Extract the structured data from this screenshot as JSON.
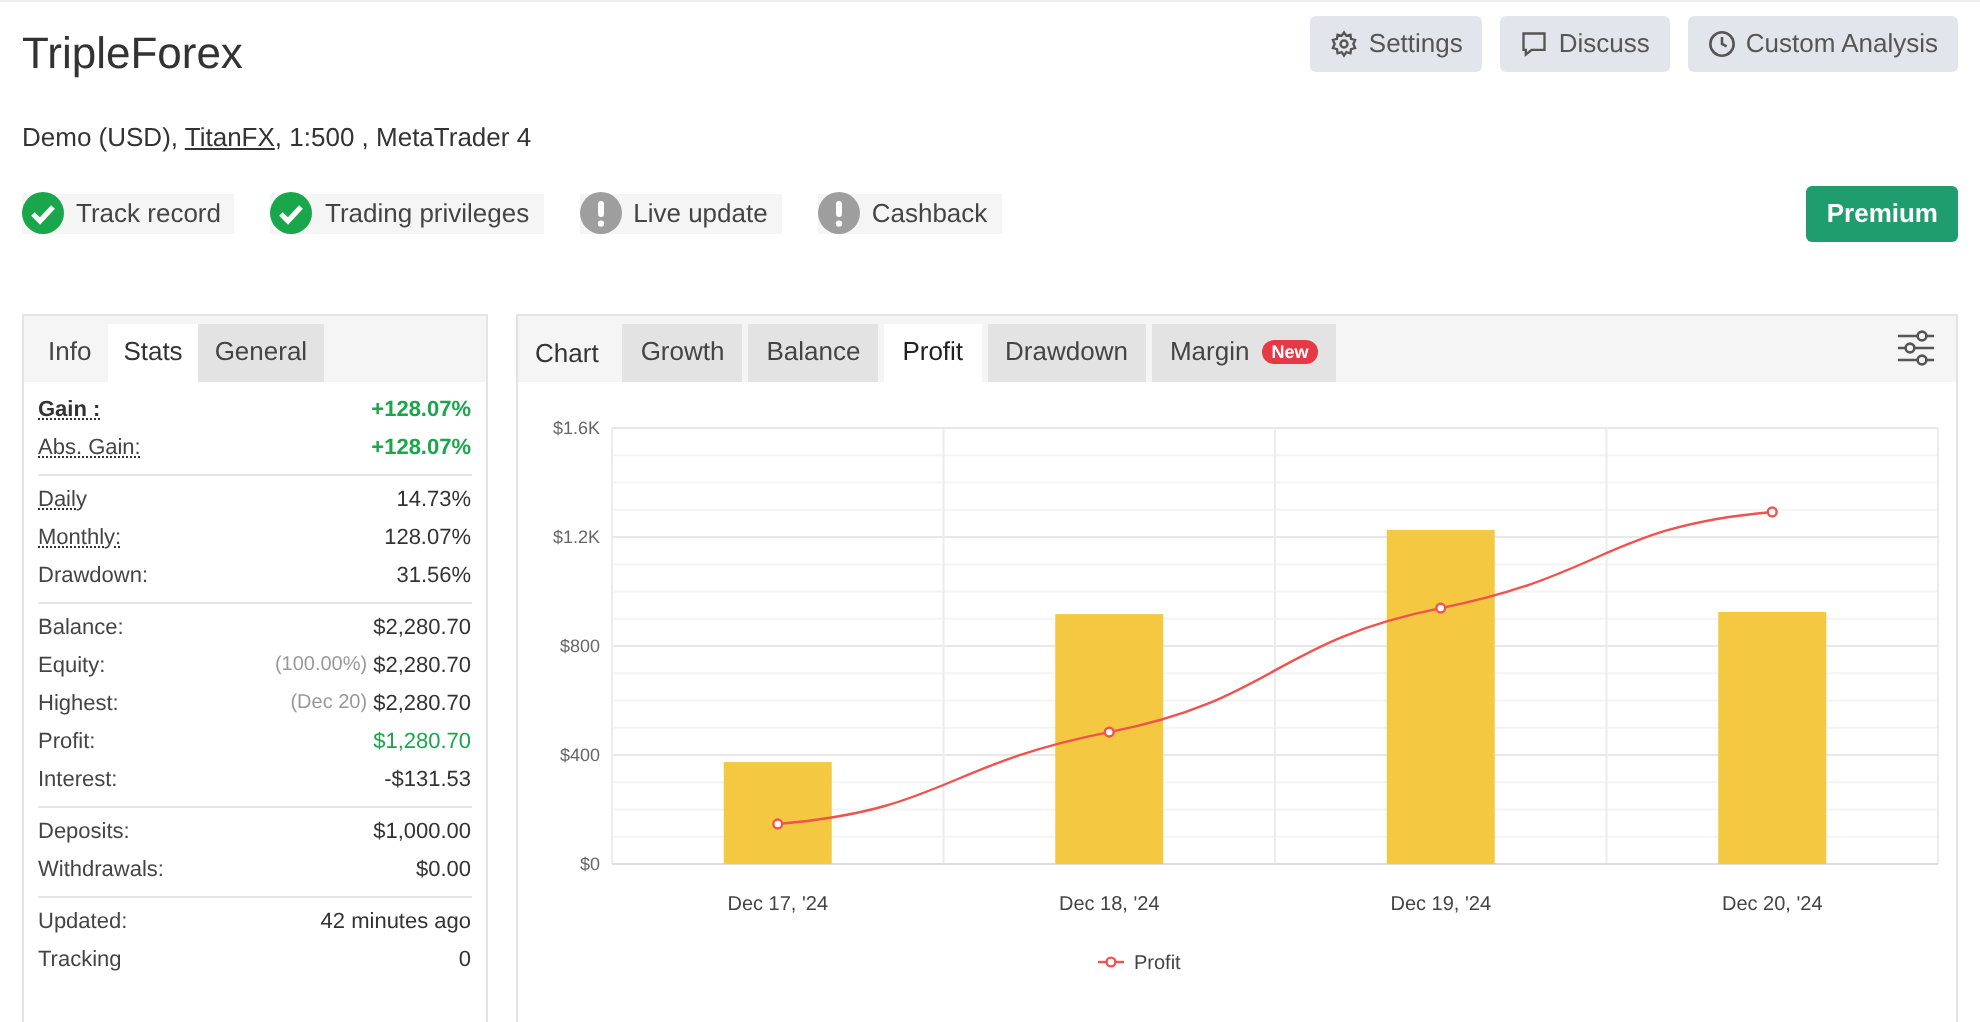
{
  "title": "TripleForex",
  "subtitle": {
    "before": "Demo (USD), ",
    "link": "TitanFX",
    "after": ", 1:500 , MetaTrader 4"
  },
  "header_buttons": [
    {
      "label": "Settings",
      "kind": "gear"
    },
    {
      "label": "Discuss",
      "kind": "chat"
    },
    {
      "label": "Custom Analysis",
      "kind": "clock"
    }
  ],
  "badges": [
    {
      "label": "Track record",
      "verified": true
    },
    {
      "label": "Trading privileges",
      "verified": true
    },
    {
      "label": "Live update",
      "verified": false
    },
    {
      "label": "Cashback",
      "verified": false
    }
  ],
  "premium_button": "Premium",
  "stats_tabs": [
    {
      "label": "Info",
      "selected": false
    },
    {
      "label": "Stats",
      "selected": true
    },
    {
      "label": "General",
      "selected": false
    }
  ],
  "stats_groups": [
    [
      {
        "label": "Gain :",
        "value": "+128.07%",
        "positive": true,
        "hint": true,
        "bold": true
      },
      {
        "label": "Abs. Gain:",
        "value": "+128.07%",
        "positive": true,
        "hint": true,
        "bold": false
      }
    ],
    [
      {
        "label": "Daily",
        "value": "14.73%",
        "positive": false,
        "hint": true,
        "bold": false
      },
      {
        "label": "Monthly:",
        "value": "128.07%",
        "positive": false,
        "hint": true,
        "bold": false
      },
      {
        "label": "Drawdown:",
        "value": "31.56%",
        "positive": false,
        "hint": false,
        "bold": false
      }
    ],
    [
      {
        "label": "Balance:",
        "value": "$2,280.70",
        "positive": false,
        "hint": false,
        "bold": false
      },
      {
        "label": "Equity:",
        "note": "(100.00%)",
        "value": "$2,280.70",
        "positive": false,
        "hint": false,
        "bold": false
      },
      {
        "label": "Highest:",
        "note": "(Dec 20)",
        "value": "$2,280.70",
        "positive": false,
        "hint": false,
        "bold": false
      },
      {
        "label": "Profit:",
        "value": "$1,280.70",
        "positive": true,
        "hint": false,
        "bold": false
      },
      {
        "label": "Interest:",
        "value": "-$131.53",
        "positive": false,
        "hint": false,
        "bold": false
      }
    ],
    [
      {
        "label": "Deposits:",
        "value": "$1,000.00",
        "positive": false,
        "hint": false,
        "bold": false
      },
      {
        "label": "Withdrawals:",
        "value": "$0.00",
        "positive": false,
        "hint": false,
        "bold": false
      }
    ],
    [
      {
        "label": "Updated:",
        "value": "42 minutes ago",
        "positive": false,
        "hint": false,
        "bold": false
      },
      {
        "label": "Tracking",
        "value": "0",
        "positive": false,
        "hint": false,
        "bold": false
      }
    ]
  ],
  "chart_label": "Chart",
  "chart_tabs": [
    {
      "label": "Growth",
      "selected": false
    },
    {
      "label": "Balance",
      "selected": false
    },
    {
      "label": "Profit",
      "selected": true
    },
    {
      "label": "Drawdown",
      "selected": false
    },
    {
      "label": "Margin",
      "selected": false,
      "badge": "New"
    }
  ],
  "chart_data": {
    "type": "bar",
    "grid": true,
    "categories": [
      "Dec 17, '24",
      "Dec 18, '24",
      "Dec 19, '24",
      "Dec 20, '24"
    ],
    "series": [
      {
        "color": "#f5c842",
        "values": [
          374,
          917,
          1226,
          925
        ]
      },
      {
        "name": "Profit",
        "type": "line",
        "marker": "circle",
        "color": "#ef5350",
        "values": [
          147,
          484,
          939,
          1292
        ]
      }
    ],
    "ylim": [
      0,
      1600
    ],
    "yticks": [
      {
        "value": 0,
        "label": "$0"
      },
      {
        "value": 400,
        "label": "$400"
      },
      {
        "value": 800,
        "label": "$800"
      },
      {
        "value": 1200,
        "label": "$1.2K"
      },
      {
        "value": 1600,
        "label": "$1.6K"
      }
    ]
  }
}
